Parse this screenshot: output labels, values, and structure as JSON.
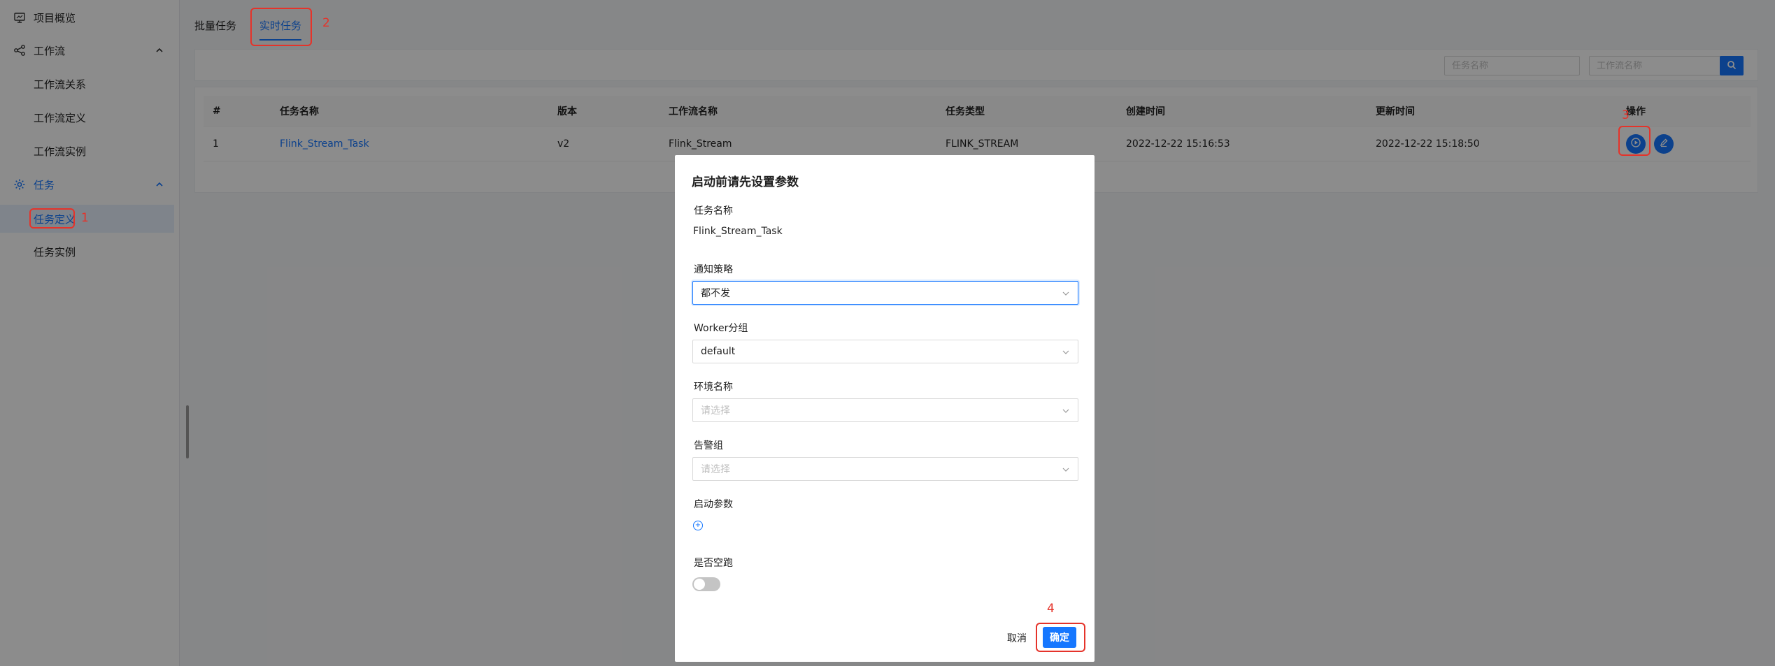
{
  "sidebar": {
    "items": [
      {
        "label": "项目概览",
        "icon": "monitor-icon"
      },
      {
        "label": "工作流",
        "icon": "workflow-icon"
      },
      {
        "label": "工作流关系"
      },
      {
        "label": "工作流定义"
      },
      {
        "label": "工作流实例"
      },
      {
        "label": "任务",
        "icon": "gear-icon"
      },
      {
        "label": "任务定义"
      },
      {
        "label": "任务实例"
      }
    ]
  },
  "tabs": [
    {
      "label": "批量任务"
    },
    {
      "label": "实时任务"
    }
  ],
  "search": {
    "task_name_placeholder": "任务名称",
    "workflow_name_placeholder": "工作流名称"
  },
  "table": {
    "columns": [
      "#",
      "任务名称",
      "版本",
      "工作流名称",
      "任务类型",
      "创建时间",
      "更新时间",
      "操作"
    ],
    "rows": [
      {
        "index": "1",
        "task_name": "Flink_Stream_Task",
        "version": "v2",
        "workflow_name": "Flink_Stream",
        "task_type": "FLINK_STREAM",
        "created": "2022-12-22 15:16:53",
        "updated": "2022-12-22 15:18:50"
      }
    ]
  },
  "modal": {
    "title": "启动前请先设置参数",
    "task_name_label": "任务名称",
    "task_name_value": "Flink_Stream_Task",
    "notify_label": "通知策略",
    "notify_value": "都不发",
    "worker_label": "Worker分组",
    "worker_value": "default",
    "env_label": "环境名称",
    "env_placeholder": "请选择",
    "alert_label": "告警组",
    "alert_placeholder": "请选择",
    "startup_params_label": "启动参数",
    "dry_run_label": "是否空跑",
    "cancel_label": "取消",
    "confirm_label": "确定"
  },
  "annotations": [
    "1",
    "2",
    "3",
    "4"
  ],
  "colors": {
    "accent": "#1677ff",
    "annotation": "#e5332a"
  }
}
